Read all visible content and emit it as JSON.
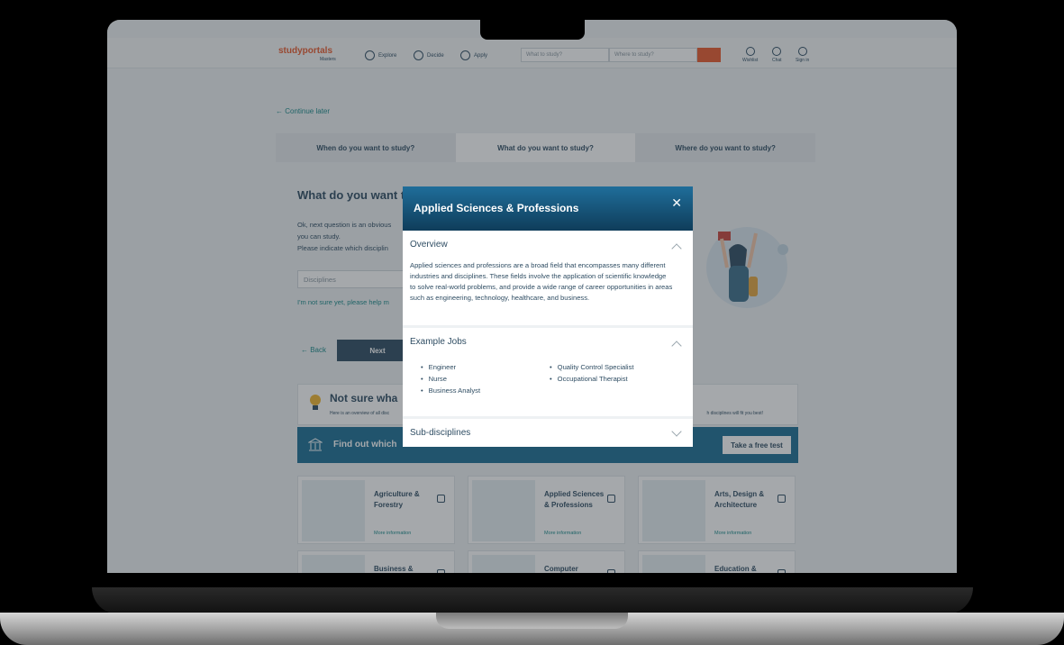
{
  "header": {
    "logo_text": "studyportals",
    "logo_sub": "Masters",
    "nav": [
      {
        "label": "Explore"
      },
      {
        "label": "Decide"
      },
      {
        "label": "Apply"
      }
    ],
    "search_what": "What to study?",
    "search_where": "Where to study?",
    "utils": [
      {
        "label": "Wishlist"
      },
      {
        "label": "Chat"
      },
      {
        "label": "Sign in"
      }
    ]
  },
  "page": {
    "continue_later": "← Continue later",
    "steps": [
      "When do you want to study?",
      "What do you want to study?",
      "Where do you want to study?"
    ],
    "question_title": "What do you want t",
    "question_text_1": "Ok, next question is an obvious",
    "question_text_2": "you can study.",
    "question_text_3": "Please indicate which disciplin",
    "disciplines_placeholder": "Disciplines",
    "not_sure_link": "I'm not sure yet, please help m",
    "back_label": "← Back",
    "next_label": "Next",
    "tips_title": "Not sure wha",
    "tips_sub": "Here is an overview of all disc",
    "tips_right": "h disciplines will fit you best!",
    "banner_text": "Find out which",
    "banner_button": "Take a free test",
    "cards": [
      {
        "title": "Agriculture & Forestry",
        "link": "More information"
      },
      {
        "title": "Applied Sciences & Professions",
        "link": "More information"
      },
      {
        "title": "Arts, Design & Architecture",
        "link": "More information"
      },
      {
        "title": "Business &",
        "link": ""
      },
      {
        "title": "Computer Science",
        "link": ""
      },
      {
        "title": "Education &",
        "link": ""
      }
    ]
  },
  "modal": {
    "title": "Applied Sciences & Professions",
    "overview_heading": "Overview",
    "overview_text": "Applied sciences and professions are a broad field that encompasses many different industries and disciplines. These fields involve the application of scientific knowledge to solve real-world problems, and provide a wide range of career opportunities in areas such as engineering, technology, healthcare, and business.",
    "jobs_heading": "Example Jobs",
    "jobs": [
      "Engineer",
      "Quality Control Specialist",
      "Nurse",
      "Occupational Therapist",
      "Business Analyst"
    ],
    "subdisciplines_heading": "Sub-disciplines"
  },
  "colors": {
    "brand": "#e85a2d",
    "primary": "#2f4d63",
    "link": "#1a8a8a",
    "banner": "#1d6f95"
  }
}
